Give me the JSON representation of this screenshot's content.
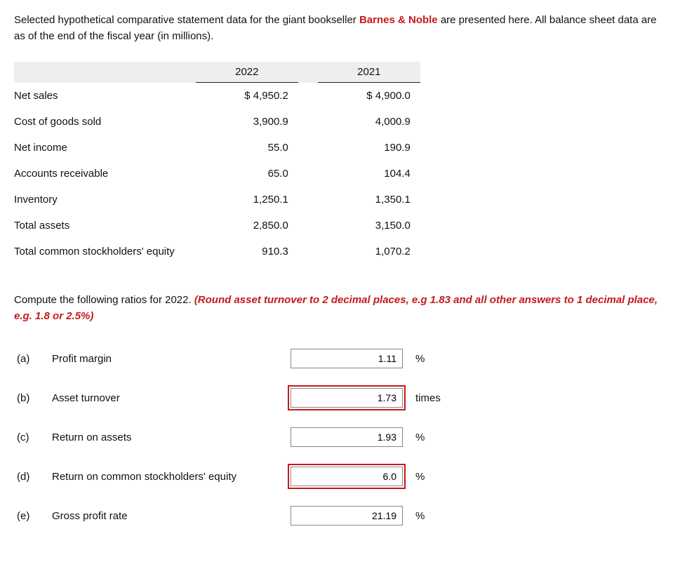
{
  "intro": {
    "pre": "Selected hypothetical comparative statement data for the giant bookseller ",
    "brand": "Barnes & Noble",
    "post": " are presented here. All balance sheet data are as of the end of the fiscal year (in millions)."
  },
  "table": {
    "headers": {
      "y1": "2022",
      "y2": "2021"
    },
    "rows": [
      {
        "label": "Net sales",
        "y1": "$ 4,950.2",
        "y2": "$ 4,900.0"
      },
      {
        "label": "Cost of goods sold",
        "y1": "3,900.9",
        "y2": "4,000.9"
      },
      {
        "label": "Net income",
        "y1": "55.0",
        "y2": "190.9"
      },
      {
        "label": "Accounts receivable",
        "y1": "65.0",
        "y2": "104.4"
      },
      {
        "label": "Inventory",
        "y1": "1,250.1",
        "y2": "1,350.1"
      },
      {
        "label": "Total assets",
        "y1": "2,850.0",
        "y2": "3,150.0"
      },
      {
        "label": "Total common stockholders' equity",
        "y1": "910.3",
        "y2": "1,070.2"
      }
    ]
  },
  "instruction": {
    "lead": "Compute the following ratios for 2022. ",
    "note": "(Round asset turnover to 2 decimal places, e.g 1.83 and all other answers to 1 decimal place, e.g. 1.8 or 2.5%)"
  },
  "ratios": [
    {
      "id": "(a)",
      "label": "Profit margin",
      "value": "1.11",
      "unit": "%",
      "highlight": false
    },
    {
      "id": "(b)",
      "label": "Asset turnover",
      "value": "1.73",
      "unit": "times",
      "highlight": true
    },
    {
      "id": "(c)",
      "label": "Return on assets",
      "value": "1.93",
      "unit": "%",
      "highlight": false
    },
    {
      "id": "(d)",
      "label": "Return on common stockholders' equity",
      "value": "6.0",
      "unit": "%",
      "highlight": true
    },
    {
      "id": "(e)",
      "label": "Gross profit rate",
      "value": "21.19",
      "unit": "%",
      "highlight": false
    }
  ]
}
